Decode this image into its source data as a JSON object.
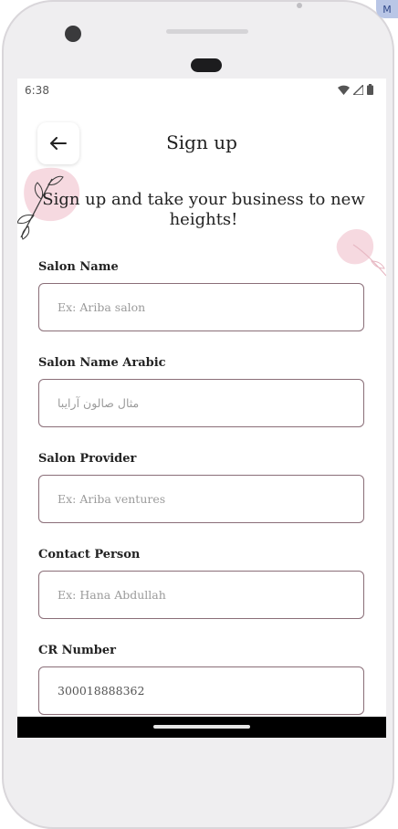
{
  "device": {
    "badge": "M"
  },
  "status_bar": {
    "time": "6:38"
  },
  "header": {
    "title": "Sign up",
    "back_icon": "arrow-left-icon"
  },
  "subtitle": "Sign up and take your business to new heights!",
  "form": {
    "fields": [
      {
        "label": "Salon Name",
        "placeholder": "Ex: Ariba salon",
        "value": ""
      },
      {
        "label": "Salon Name Arabic",
        "placeholder": "مثال صالون آرايبا",
        "value": ""
      },
      {
        "label": "Salon Provider",
        "placeholder": "Ex: Ariba ventures",
        "value": ""
      },
      {
        "label": "Contact Person",
        "placeholder": "Ex: Hana Abdullah",
        "value": ""
      },
      {
        "label": "CR Number",
        "placeholder": "",
        "value": "300018888362"
      }
    ]
  },
  "colors": {
    "input_border": "#8a6e78",
    "accent_pink": "#f6d9e0",
    "frame": "#efeef0"
  }
}
